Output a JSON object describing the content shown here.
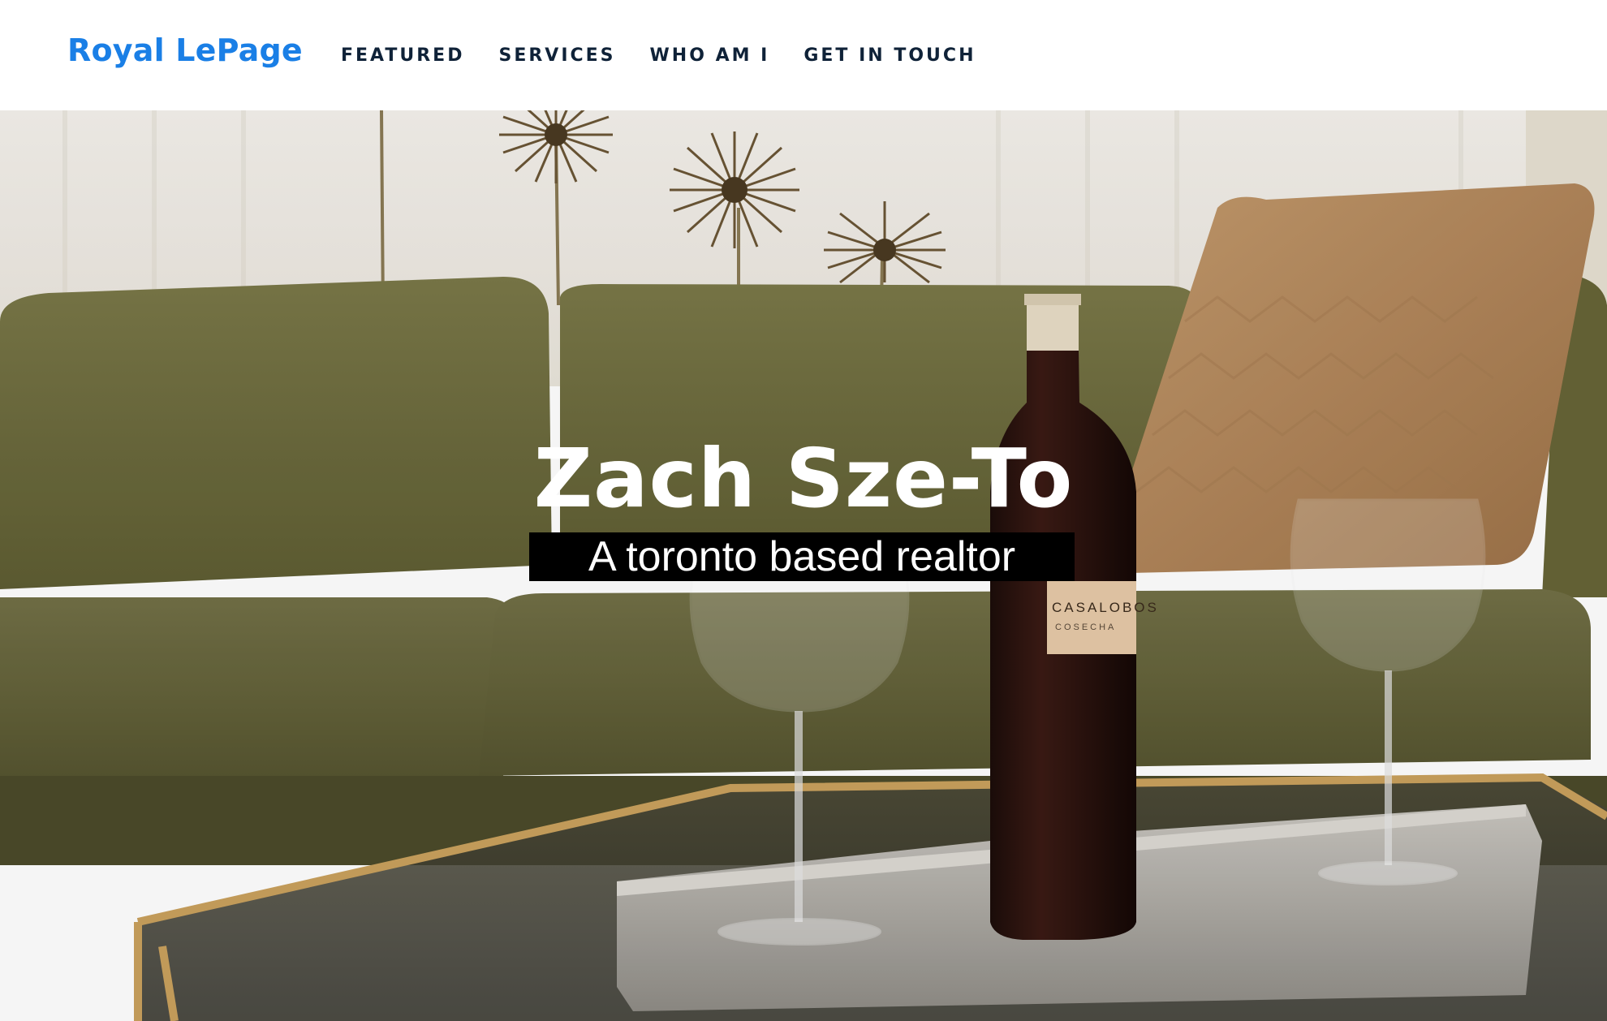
{
  "brand": {
    "name": "Royal LePage",
    "color": "#1a7fe6"
  },
  "nav": {
    "items": [
      {
        "label": "FEATURED"
      },
      {
        "label": "SERVICES"
      },
      {
        "label": "WHO AM I"
      },
      {
        "label": "GET IN TOUCH"
      }
    ]
  },
  "hero": {
    "title": "Zach Sze-To",
    "subtitle": "A toronto based realtor",
    "wine_label": "CASALOBOS",
    "wine_sublabel": "COSECHA"
  },
  "colors": {
    "nav_text": "#0f2238",
    "sofa": "#6b6a3e",
    "pillow": "#b88a5c"
  }
}
